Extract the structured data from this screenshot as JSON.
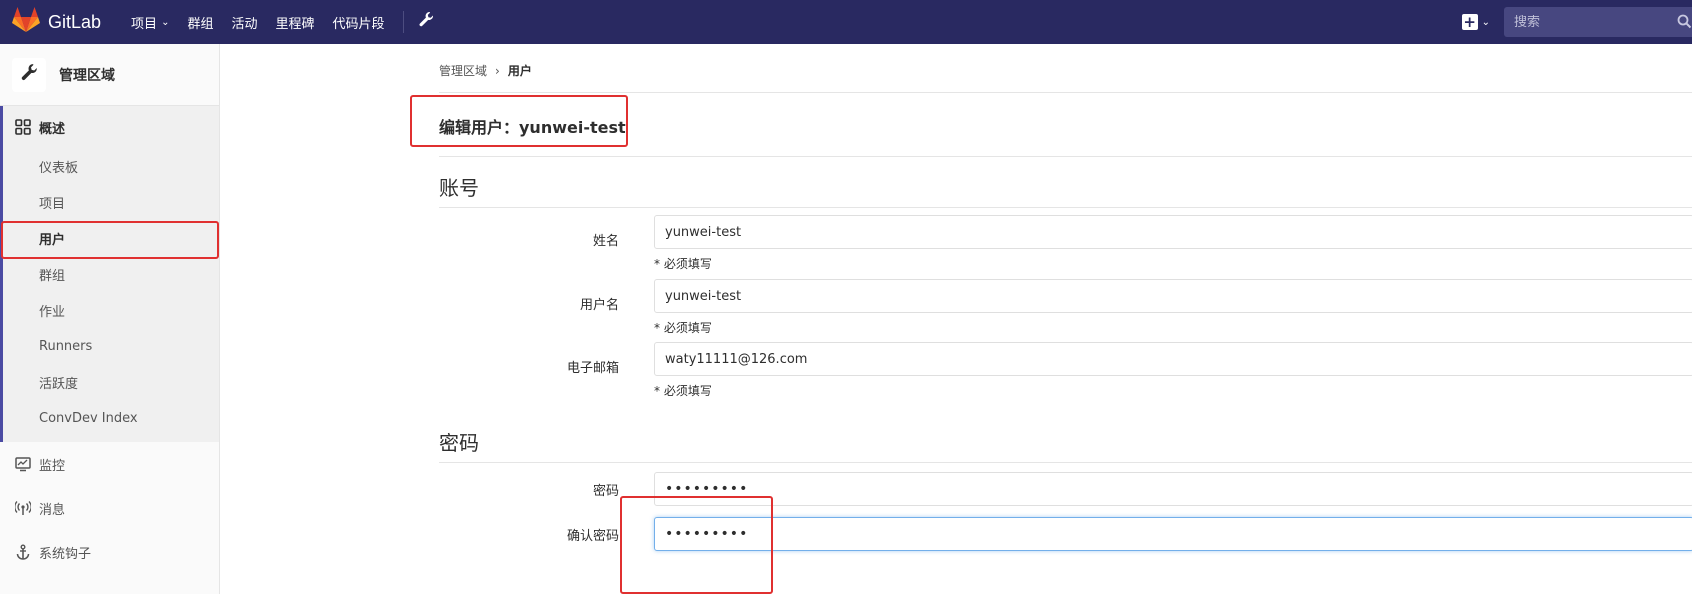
{
  "navbar": {
    "brand": "GitLab",
    "links": [
      {
        "label": "项目",
        "has_caret": true
      },
      {
        "label": "群组",
        "has_caret": false
      },
      {
        "label": "活动",
        "has_caret": false
      },
      {
        "label": "里程碑",
        "has_caret": false
      },
      {
        "label": "代码片段",
        "has_caret": false
      }
    ],
    "search_placeholder": "搜索",
    "bg_color": "#292961"
  },
  "sidebar": {
    "title": "管理区域",
    "active_group": {
      "label": "概述",
      "items": [
        {
          "label": "仪表板",
          "active": false
        },
        {
          "label": "项目",
          "active": false
        },
        {
          "label": "用户",
          "active": true
        },
        {
          "label": "群组",
          "active": false
        },
        {
          "label": "作业",
          "active": false
        },
        {
          "label": "Runners",
          "active": false
        },
        {
          "label": "活跃度",
          "active": false
        },
        {
          "label": "ConvDev Index",
          "active": false
        }
      ]
    },
    "items": [
      {
        "label": "监控",
        "icon": "monitor-icon"
      },
      {
        "label": "消息",
        "icon": "broadcast-icon"
      },
      {
        "label": "系统钩子",
        "icon": "anchor-icon"
      }
    ]
  },
  "breadcrumb": {
    "parent": "管理区域",
    "current": "用户"
  },
  "page": {
    "title": "编辑用户：yunwei-test"
  },
  "account_section": {
    "title": "账号",
    "fields": [
      {
        "label": "姓名",
        "value": "yunwei-test",
        "hint": "* 必须填写"
      },
      {
        "label": "用户名",
        "value": "yunwei-test",
        "hint": "* 必须填写"
      },
      {
        "label": "电子邮箱",
        "value": "waty11111@126.com",
        "hint": "* 必须填写"
      }
    ]
  },
  "password_section": {
    "title": "密码",
    "fields": [
      {
        "label": "密码",
        "value": "•••••••••"
      },
      {
        "label": "确认密码",
        "value": "•••••••••"
      }
    ]
  },
  "colors": {
    "annotation_red": "#e03030",
    "sidebar_accent": "#4b4ba3",
    "focus_border": "#73afea"
  }
}
